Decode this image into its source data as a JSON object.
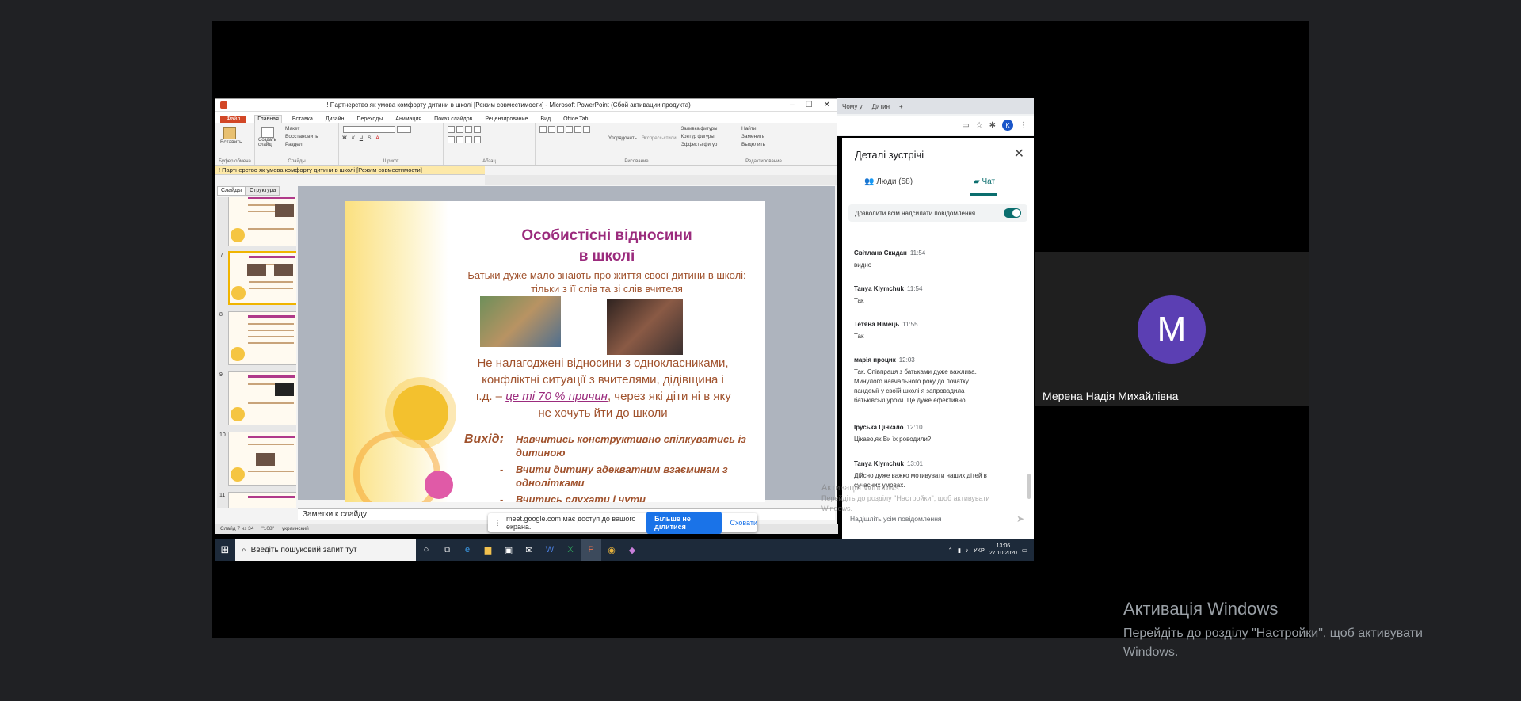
{
  "colors": {
    "accent_meet": "#0b6e6e",
    "avatar": "#5b3fb3",
    "ppt_file_tab": "#d24726",
    "slide_title": "#9b2b7d",
    "slide_text": "#a0522d",
    "share_stop": "#1a73e8"
  },
  "ppt": {
    "window_title": "! Партнерство як умова комфорту дитини в школі [Режим совместимости] - Microsoft PowerPoint (Сбой активации продукта)",
    "ribbon_tabs": [
      "Файл",
      "Главная",
      "Вставка",
      "Дизайн",
      "Переходы",
      "Анимация",
      "Показ слайдов",
      "Рецензирование",
      "Вид",
      "Office Tab"
    ],
    "ribbon_groups": {
      "clipboard": "Буфер обмена",
      "paste": "Вставить",
      "slides": "Слайды",
      "create_slide": "Создать слайд",
      "layout": "Макет",
      "reset": "Восстановить",
      "section": "Раздел",
      "font": "Шрифт",
      "paragraph": "Абзац",
      "drawing": "Рисование",
      "arrange": "Упорядочить",
      "quick_styles": "Экспресс-стили",
      "shape_fill": "Заливка фигуры",
      "shape_outline": "Контур фигуры",
      "shape_effects": "Эффекты фигур",
      "editing": "Редактирование",
      "find": "Найти",
      "replace": "Заменить",
      "select": "Выделить"
    },
    "doc_tab": "! Партнерство як умова комфорту дитини в школі [Режим совместимости]",
    "pane_tabs": [
      "Слайды",
      "Структура"
    ],
    "thumb_numbers": [
      "6",
      "7",
      "8",
      "9",
      "10",
      "11"
    ],
    "notes_placeholder": "Заметки к слайду",
    "status": {
      "slide": "Слайд 7 из 34",
      "theme": "\"108\"",
      "lang": "украинский"
    }
  },
  "slide": {
    "title_line1": "Особистісні відносини",
    "title_line2": "в школі",
    "sub_line1": "Батьки дуже мало знають  про життя своєї дитини в школі:",
    "sub_line2": "тільки з її слів та зі слів вчителя",
    "body_line1": "Не налагоджені відносини з однокласниками,",
    "body_line2": "конфліктні ситуації з вчителями, дідівщина і",
    "body_line3_a": "т.д. – ",
    "body_line3_b": "це ті 70 % причин",
    "body_line3_c": ", через які діти ні в яку",
    "body_line4": "не хочуть йти до школи",
    "outcome_label": "Вихід:",
    "items": [
      "Навчитись конструктивно спілкуватись із дитиною",
      "Вчити дитину адекватним взаєминам з однолітками",
      "Вчитись слухати і чути"
    ],
    "dash": "-"
  },
  "share_bar": {
    "text": "meet.google.com має доступ до вашого екрана.",
    "stop_label": "Більше не ділитися",
    "hide_label": "Сховати"
  },
  "chrome": {
    "tab1": "Чому у",
    "tab2": "Дитин",
    "profile_letter": "K"
  },
  "meet_panel": {
    "title": "Деталі зустрічі",
    "people_tab": "Люди (58)",
    "chat_tab": "Чат",
    "allow_messages": "Дозволити всім надсилати повідомлення",
    "messages": [
      {
        "sender": "Світлана Скидан",
        "time": "11:54",
        "text": "видно"
      },
      {
        "sender": "Tanya Klymchuk",
        "time": "11:54",
        "text": "Так"
      },
      {
        "sender": "Тетяна Німець",
        "time": "11:55",
        "text": "Так"
      },
      {
        "sender": "марія процик",
        "time": "12:03",
        "text": "Так. Співпраця з батьками дуже важлива. Минулого навчального року до початку пандемії у своїй школі я запровадила батьківські уроки. Це дуже ефективно!"
      },
      {
        "sender": "Іруська Цінкало",
        "time": "12:10",
        "text": "Цікаво,як Ви їх роводили?"
      },
      {
        "sender": "Tanya Klymchuk",
        "time": "13:01",
        "text": "Дійсно дуже важко мотивувати наших дітей в сучасних умовах."
      }
    ],
    "input_placeholder": "Надішліть усім повідомлення",
    "ghost_activation_1": "Активація Windows",
    "ghost_activation_2": "Перейдіть до розділу \"Настройки\", щоб активувати Windows."
  },
  "taskbar": {
    "search_placeholder": "Введіть пошуковий запит тут",
    "lang": "УКР",
    "time": "13:06",
    "date": "27.10.2020"
  },
  "participant": {
    "initial": "M",
    "name": "Мерена Надія Михайлівна"
  },
  "activation": {
    "title": "Активація Windows",
    "subtitle": "Перейдіть до розділу \"Настройки\", щоб активувати Windows."
  }
}
